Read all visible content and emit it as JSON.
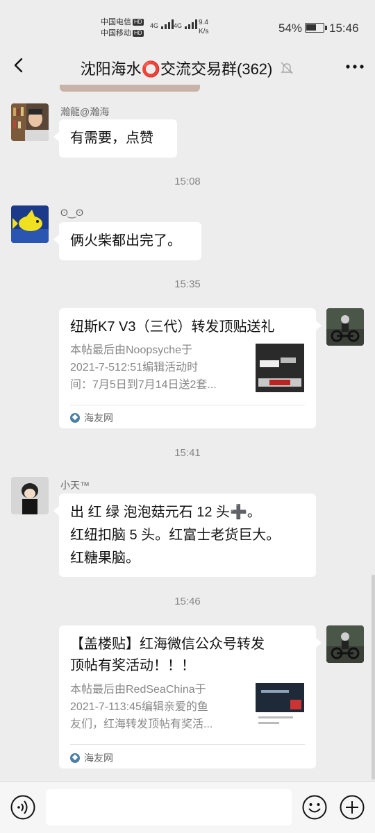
{
  "status_bar": {
    "carrier1": "中国电信",
    "carrier2": "中国移动",
    "hd": "HD",
    "net1": "4G",
    "net2": "4G",
    "speed_value": "9.4",
    "speed_unit": "K/s",
    "battery": "54%",
    "time": "15:46"
  },
  "header": {
    "title": "沈阳海水⭕交流交易群(362)",
    "icons": {
      "back": "chevron-left-icon",
      "mute": "bell-off-icon",
      "more": "more-dots-icon"
    }
  },
  "messages": {
    "m1": {
      "sender": "瀚龍@瀚海",
      "text": "有需要，点赞"
    },
    "t1": "15:08",
    "m2": {
      "sender": "ʘ‿ʘ",
      "text": "俩火柴都出完了。"
    },
    "t2": "15:35",
    "m3": {
      "title": "纽斯K7 V3（三代）转发顶贴送礼",
      "desc": "本帖最后由Noopsyche于2021-7-512:51编辑活动时间：7月5日到7月14日送2套...",
      "desc_l1": "本帖最后由Noopsyche于",
      "desc_l2": "2021-7-512:51编辑活动时",
      "desc_l3": "间：7月5日到7月14日送2套...",
      "source": "海友网"
    },
    "t3": "15:41",
    "m4": {
      "sender": "小天™",
      "line1": "出   红 绿 泡泡菇元石 12 头➕。",
      "line2": "红纽扣脑 5 头。红富士老货巨大。",
      "line3": "红糖果脑。"
    },
    "t4": "15:46",
    "m5": {
      "title_l1": "【盖楼贴】红海微信公众号转发",
      "title_l2": "顶帖有奖活动！！！",
      "desc_l1": "本帖最后由RedSeaChina于",
      "desc_l2": "2021-7-113:45编辑亲爱的鱼",
      "desc_l3": "友们，红海转发顶帖有奖活...",
      "source": "海友网"
    }
  },
  "input_bar": {
    "placeholder": "",
    "icons": {
      "voice": "voice-icon",
      "emoji": "emoji-icon",
      "plus": "plus-icon"
    }
  },
  "colors": {
    "background": "#ededed",
    "bubble": "#ffffff",
    "input_bar": "#f6f6f6",
    "muted_text": "#888888"
  }
}
